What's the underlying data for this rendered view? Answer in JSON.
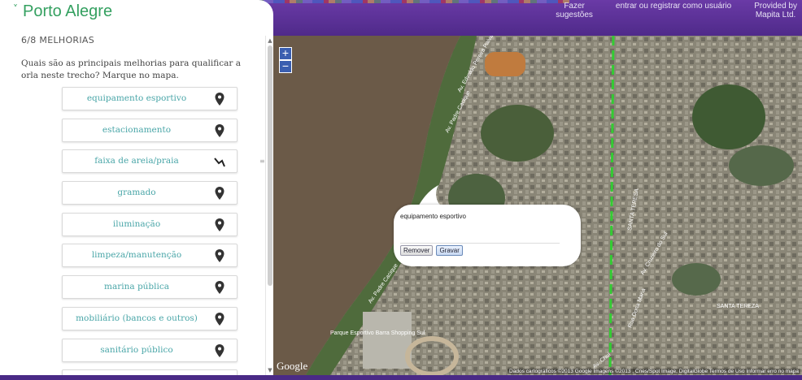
{
  "header": {
    "city": "Porto Alegre",
    "links": [
      {
        "label": "Fazer\nsugestões"
      },
      {
        "label": "entrar ou registrar como usuário"
      },
      {
        "label": "Provided by\nMapita Ltd."
      }
    ]
  },
  "sidebar": {
    "section": "6/8 MELHORIAS",
    "question": "Quais são as principais melhorias para qualificar a orla neste trecho? Marque no mapa.",
    "items": [
      {
        "label": "equipamento esportivo",
        "icon": "map-pin-icon"
      },
      {
        "label": "estacionamento",
        "icon": "map-pin-icon"
      },
      {
        "label": "faixa de areia/praia",
        "icon": "line-draw-icon"
      },
      {
        "label": "gramado",
        "icon": "map-pin-icon"
      },
      {
        "label": "iluminação",
        "icon": "map-pin-icon"
      },
      {
        "label": "limpeza/manutenção",
        "icon": "map-pin-icon"
      },
      {
        "label": "marina pública",
        "icon": "map-pin-icon"
      },
      {
        "label": "mobiliário (bancos e outros)",
        "icon": "map-pin-icon"
      },
      {
        "label": "sanitário público",
        "icon": "map-pin-icon"
      }
    ]
  },
  "map": {
    "zoom_in": "+",
    "zoom_out": "−",
    "google": "Google",
    "attribution": "Dados cartográficos ©2013 Google Imagens ©2013 , Cnes/Spot Image, DigitalGlobe   Termos de Uso   Informar erro no mapa",
    "labels": [
      "Av. Padre Cacique",
      "Av. Edvaldo Pereira Paiva",
      "Av. Padre Cacique",
      "SANTA TERESA",
      "SANTA TEREZA",
      "Av. Chuí",
      "Av. Cruzeiro do Sul",
      "Rua Dona Maria",
      "Parque Esportivo Barra Shopping Sul"
    ],
    "popup": {
      "title": "equipamento esportivo",
      "remove": "Remover",
      "save": "Gravar"
    }
  },
  "colors": {
    "header": "#5a2f96",
    "city": "#34a060",
    "item_text": "#4aa6a8",
    "dashed_line": "#33cc33"
  }
}
